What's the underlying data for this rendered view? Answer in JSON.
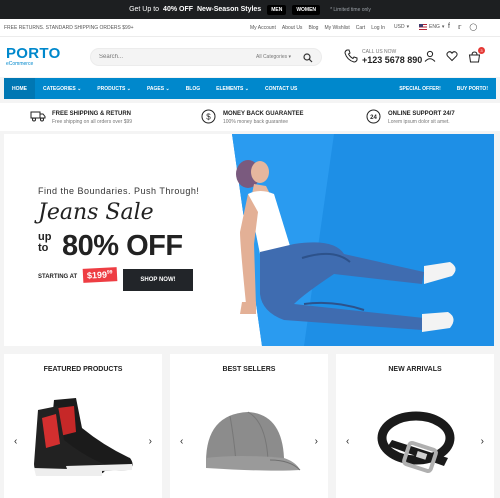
{
  "promo": {
    "text_before": "Get Up to",
    "text_bold": "40% OFF",
    "text_after": "New-Season Styles",
    "pill_men": "MEN",
    "pill_women": "WOMEN",
    "limited": "* Limited time only"
  },
  "util": {
    "shipping": "FREE RETURNS. STANDARD SHIPPING ORDERS $99+",
    "links": [
      "My Account",
      "About Us",
      "Blog",
      "My Wishlist",
      "Cart",
      "Log In"
    ],
    "currency": "USD",
    "language": "ENG",
    "social_icons": [
      "facebook-icon",
      "twitter-icon",
      "instagram-icon"
    ]
  },
  "header": {
    "logo_main": "PORTO",
    "logo_sub": "eCommerce",
    "search_placeholder": "Search...",
    "search_category": "All Categories",
    "call_label": "CALL US NOW",
    "call_number": "+123 5678 890",
    "cart_count": "3"
  },
  "nav": {
    "items": [
      "HOME",
      "CATEGORIES",
      "PRODUCTS",
      "PAGES",
      "BLOG",
      "ELEMENTS",
      "CONTACT US"
    ],
    "special": "SPECIAL OFFER!",
    "buy": "BUY PORTO!"
  },
  "info": [
    {
      "title": "FREE SHIPPING & RETURN",
      "sub": "Free shipping on all orders over $99",
      "icon": "truck-icon"
    },
    {
      "title": "MONEY BACK GUARANTEE",
      "sub": "100% money back guarantee",
      "icon": "dollar-icon"
    },
    {
      "title": "ONLINE SUPPORT 24/7",
      "sub": "Lorem ipsum dolor sit amet.",
      "icon": "support-24-icon"
    }
  ],
  "hero": {
    "tagline": "Find the Boundaries. Push Through!",
    "title": "Jeans Sale",
    "upto_1": "up",
    "upto_2": "to",
    "discount": "80% OFF",
    "starting": "STARTING AT",
    "price": "$199",
    "price_cents": "99",
    "button": "SHOP NOW!"
  },
  "cards": [
    {
      "heading": "FEATURED PRODUCTS",
      "image": "sneaker-icon"
    },
    {
      "heading": "BEST SELLERS",
      "image": "cap-icon"
    },
    {
      "heading": "NEW ARRIVALS",
      "image": "belt-icon"
    }
  ],
  "colors": {
    "brand_blue": "#0088cc",
    "dark": "#222529",
    "sale_red": "#ee3d43",
    "hero_blue": "#1e8fe6"
  }
}
